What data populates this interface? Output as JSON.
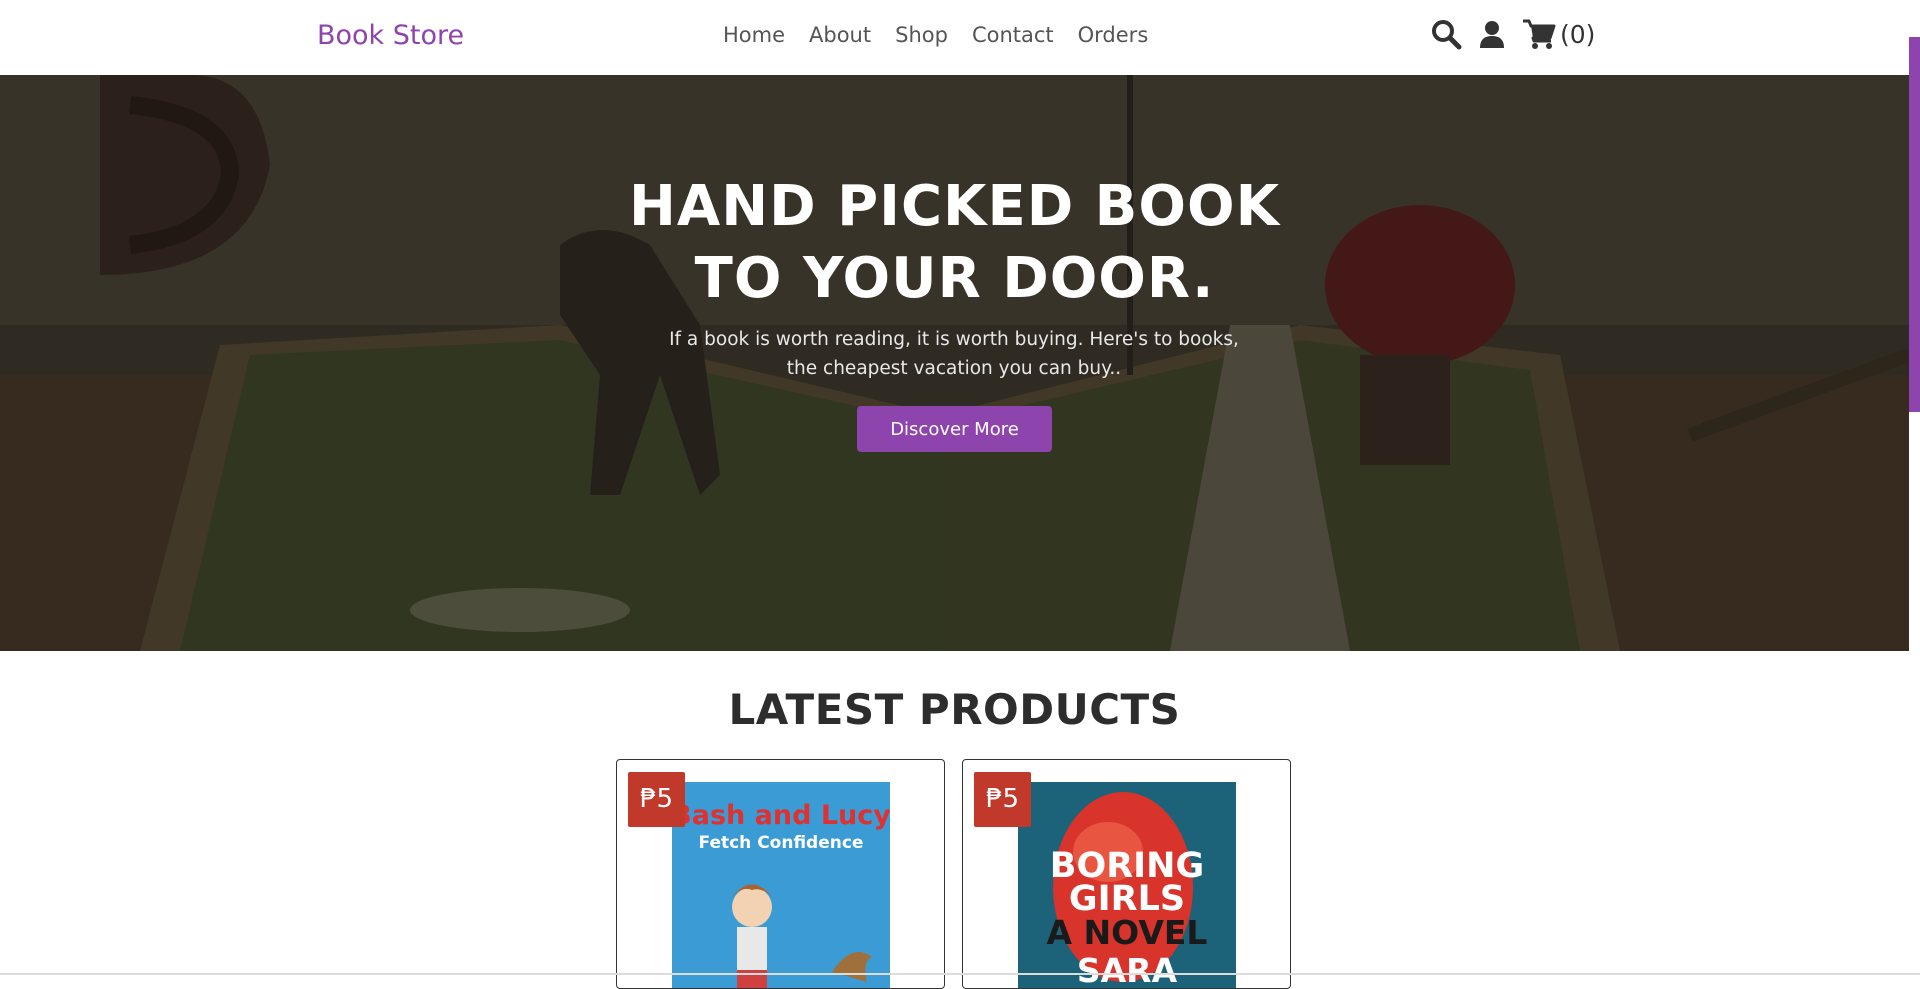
{
  "header": {
    "logo": "Book Store",
    "nav": [
      "Home",
      "About",
      "Shop",
      "Contact",
      "Orders"
    ],
    "cart_count": "(0)"
  },
  "hero": {
    "title_line1": "HAND PICKED BOOK",
    "title_line2": "TO YOUR DOOR.",
    "subtitle": "If a book is worth reading, it is worth buying. Here's to books, the cheapest vacation you can buy..",
    "button": "Discover More"
  },
  "products": {
    "title": "LATEST PRODUCTS",
    "items": [
      {
        "price": "₱5",
        "cover_title_1": "Bash and Lucy",
        "cover_title_2": "Fetch Confidence",
        "cover_bg": "#3b9bd4"
      },
      {
        "price": "₱5",
        "cover_title_1": "BORING",
        "cover_title_2": "GIRLS",
        "cover_title_3": "A NOVEL",
        "cover_title_4": "SARA",
        "cover_bg": "#1c6278"
      }
    ]
  },
  "colors": {
    "accent": "#8e44ad",
    "badge": "#c0392b"
  },
  "icons": {
    "search": "search-icon",
    "user": "user-icon",
    "cart": "cart-icon"
  }
}
